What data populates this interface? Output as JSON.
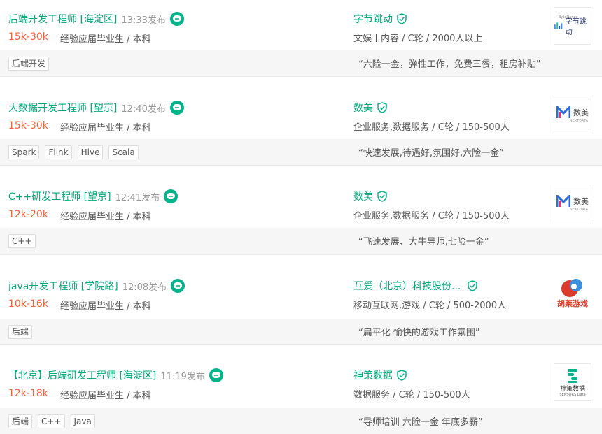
{
  "jobs": [
    {
      "title": "后端开发工程师 [海淀区]",
      "published": "13:33发布",
      "salary": "15k-30k",
      "requirement": "经验应届毕业生 / 本科",
      "company": "字节跳动",
      "industry": "文娱丨内容 / C轮 / 2000人以上",
      "logo_text": "字节跳动",
      "logo_subtext": "ByteDance",
      "tags": [
        "后端开发"
      ],
      "benefit": "“六险一金，弹性工作，免费三餐，租房补贴”"
    },
    {
      "title": "大数据开发工程师 [望京]",
      "published": "12:40发布",
      "salary": "15k-30k",
      "requirement": "经验应届毕业生 / 本科",
      "company": "数美",
      "industry": "企业服务,数据服务 / C轮 / 150-500人",
      "logo_text": "数美",
      "logo_subtext": "NEXTDATA",
      "tags": [
        "Spark",
        "Flink",
        "Hive",
        "Scala"
      ],
      "benefit": "“快速发展,待遇好,氛围好,六险一金”"
    },
    {
      "title": "C++研发工程师 [望京]",
      "published": "12:41发布",
      "salary": "12k-20k",
      "requirement": "经验应届毕业生 / 本科",
      "company": "数美",
      "industry": "企业服务,数据服务 / C轮 / 150-500人",
      "logo_text": "数美",
      "logo_subtext": "NEXTDATA",
      "tags": [
        "C++"
      ],
      "benefit": "“飞速发展、大牛导师,七险一金”"
    },
    {
      "title": "java开发工程师 [学院路]",
      "published": "12:08发布",
      "salary": "10k-16k",
      "requirement": "经验应届毕业生 / 本科",
      "company": "互爱（北京）科技股份...",
      "industry": "移动互联网,游戏 / C轮 / 500-2000人",
      "logo_text": "胡莱游戏",
      "logo_subtext": "",
      "tags": [
        "后端"
      ],
      "benefit": "“扁平化 愉快的游戏工作氛围”"
    },
    {
      "title": "【北京】后端研发工程师 [海淀区]",
      "published": "11:19发布",
      "salary": "12k-18k",
      "requirement": "经验应届毕业生 / 本科",
      "company": "神策数据",
      "industry": "数据服务 / C轮 / 150-500人",
      "logo_text": "神策数据",
      "logo_subtext": "SENSORS Data",
      "tags": [
        "后端",
        "C++",
        "Java"
      ],
      "benefit": "“导师培训 六险一金 年底多薪”"
    }
  ],
  "colors": {
    "accent": "#00a87a",
    "salary": "#fd5f39",
    "chat": "#00b38a",
    "verified": "#00b38a"
  }
}
